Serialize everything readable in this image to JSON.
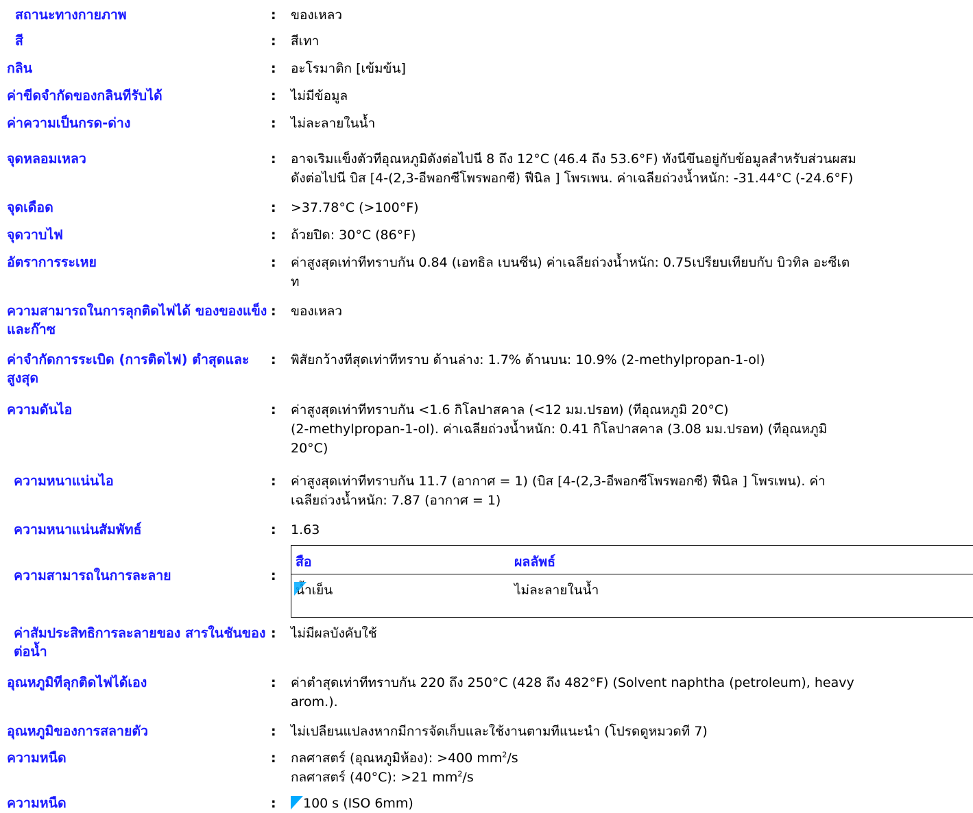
{
  "rows": [
    {
      "label": "สถานะทางกายภาพ",
      "value": [
        "ของเหลว"
      ]
    },
    {
      "label": "สี",
      "value": [
        "สีเทา"
      ]
    },
    {
      "label": "กลิน",
      "value": [
        "อะโรมาติก [เข้มข้น]"
      ]
    },
    {
      "label": "ค่าขีดจำกัดของกลินทีรับได้",
      "value": [
        "ไม่มีข้อมูล"
      ]
    },
    {
      "label": "ค่าความเป็นกรด-ด่าง",
      "value": [
        "ไม่ละลายในน้ำ"
      ]
    },
    {
      "label": "จุดหลอมเหลว",
      "value": [
        "อาจเริมแข็งตัวทีอุณหภูมิดังต่อไปนี 8 ถึง 12°C (46.4 ถึง 53.6°F) ทังนีขึนอยู่กับข้อมูลสำหรับส่วนผสม",
        "ดังต่อไปนี บิส [4-(2,3-อีพอกซีโพรพอกซี) ฟีนิล ] โพรเพน. ค่าเฉลียถ่วงน้ำหนัก: -31.44°C (-24.6°F)"
      ]
    },
    {
      "label": "จุดเดือด",
      "value": [
        ">37.78°C (>100°F)"
      ]
    },
    {
      "label": "จุดวาบไฟ",
      "value": [
        "ถ้วยปิด: 30°C (86°F)"
      ]
    },
    {
      "label": "อัตราการระเหย",
      "value": [
        "ค่าสูงสุดเท่าทีทราบกัน 0.84 (เอทธิล เบนซีน)  ค่าเฉลียถ่วงน้ำหนัก: 0.75เปรียบเทียบกับ บิวทิล อะซีเต",
        "ท"
      ]
    },
    {
      "label": "ความสามารถในการลุกติดไฟได้ ของของแข็ง และก๊าซ",
      "value": [
        "ของเหลว"
      ]
    },
    {
      "label": "ค่าจำกัดการระเบิด (การติดไฟ) ตำสุดและสูงสุด",
      "value": [
        "พิสัยกว้างทีสุดเท่าทีทราบ ด้านล่าง: 1.7%  ด้านบน: 10.9% (2-methylpropan-1-ol)"
      ]
    },
    {
      "label": "ความดันไอ",
      "value": [
        "ค่าสูงสุดเท่าทีทราบกัน <1.6 กิโลปาสคาล (<12 มม.ปรอท) (ทีอุณหภูมิ 20°C)",
        "(2-methylpropan-1-ol).  ค่าเฉลียถ่วงน้ำหนัก: 0.41 กิโลปาสคาล (3.08 มม.ปรอท) (ทีอุณหภูมิ",
        "20°C)"
      ]
    },
    {
      "label": "ความหนาแน่นไอ",
      "value": [
        "ค่าสูงสุดเท่าทีทราบกัน 11.7  (อากาศ = 1)  (บิส [4-(2,3-อีพอกซีโพรพอกซี) ฟีนิล ] โพรเพน).  ค่า",
        "เฉลียถ่วงน้ำหนัก: 7.87  (อากาศ = 1)"
      ]
    },
    {
      "label": "ความหนาแน่นสัมพัทธ์",
      "value": [
        "1.63"
      ]
    },
    {
      "label": "ความสามารถในการละลาย",
      "value": []
    },
    {
      "label": "ค่าสัมประสิทธิการละลายของ สารในชันของ ต่อน้ำ",
      "value": [
        "ไม่มีผลบังคับใช้"
      ]
    },
    {
      "label": "อุณหภูมิทีลุกติดไฟได้เอง",
      "value": [
        "ค่าตำสุดเท่าทีทราบกัน 220 ถึง 250°C (428 ถึง 482°F) (Solvent naphtha (petroleum), heavy",
        "arom.)."
      ]
    },
    {
      "label": "อุณหภูมิของการสลายตัว",
      "value": [
        "ไม่เปลียนแปลงหากมีการจัดเก็บและใช้งานตามทีแนะนำ (โปรดดูหมวดที 7)"
      ]
    },
    {
      "label": "ความหนืด",
      "value": []
    },
    {
      "label": "ความหนืด",
      "value": [
        "100 s (ISO 6mm)"
      ]
    }
  ],
  "colon": ":",
  "viscosity": {
    "line1_prefix": "กลศาสตร์ (อุณหภูมิห้อง): >400 mm",
    "line1_sup": "2",
    "line1_suffix": "/s",
    "line2_prefix": "กลศาสตร์ (40°C): >21 mm",
    "line2_sup": "2",
    "line2_suffix": "/s"
  },
  "solubility_table": {
    "header_medium": "สือ",
    "header_result": "ผลลัพธ์",
    "rows": [
      {
        "medium": "น้ำเย็น",
        "result": "ไม่ละลายในน้ำ"
      }
    ]
  },
  "colors": {
    "label": "#1a1aff",
    "flag": "#00aaff"
  }
}
